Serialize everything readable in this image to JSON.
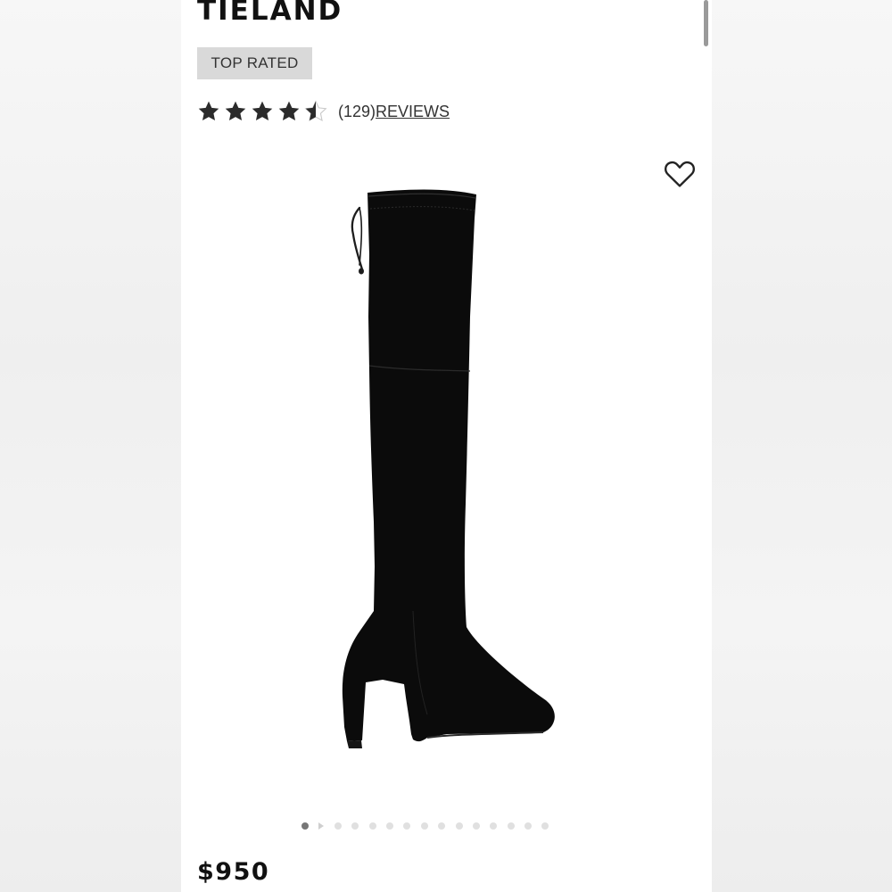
{
  "product": {
    "name": "TIELAND",
    "badge": "TOP RATED",
    "rating": 4.5,
    "rating_max": 5,
    "review_count": "(129)",
    "reviews_label": "REVIEWS",
    "price": "$950"
  },
  "icons": {
    "favorite": "heart-outline-icon",
    "star": "star-icon"
  },
  "gallery": {
    "total_slides": 15,
    "active_index": 0
  },
  "colors": {
    "text": "#111111",
    "badge_bg": "#d9d9d9",
    "star": "#2b2b2b",
    "dot_active": "#777777",
    "dot_inactive": "#e0e0e0"
  }
}
